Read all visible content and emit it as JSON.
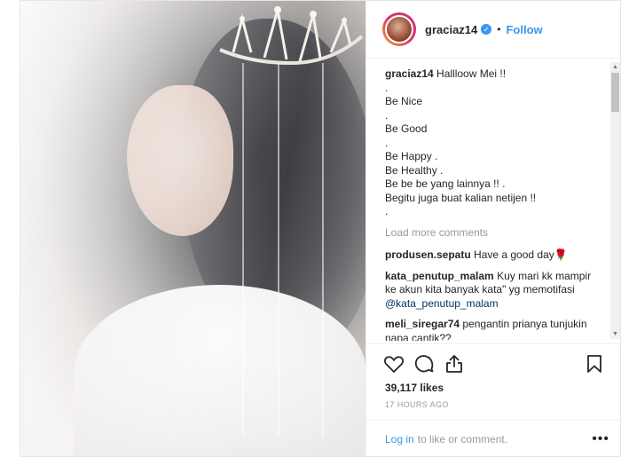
{
  "post": {
    "username": "graciaz14",
    "verified_mark": "✓",
    "separator": "•",
    "follow_label": "Follow",
    "caption": {
      "user": "graciaz14",
      "lines": [
        "Hallloow Mei !!",
        ".",
        "Be Nice",
        ".",
        "Be Good",
        ".",
        "Be Happy .",
        "Be Healthy .",
        "Be be be yang lainnya !! .",
        "Begitu juga buat kalian netijen !!",
        "."
      ]
    },
    "load_more": "Load more comments",
    "comments": [
      {
        "user": "produsen.sepatu",
        "text": "Have a good day",
        "emoji": "🌹"
      },
      {
        "user": "kata_penutup_malam",
        "text": "Kuy mari kk mampir",
        "text_line2": "ke akun kita banyak kata\" yg memotifasi",
        "mention": "@kata_penutup_malam"
      },
      {
        "user": "meli_siregar74",
        "text": "pengantin prianya tunjukin",
        "text_line2": "napa cantik??"
      }
    ],
    "likes": "39,117 likes",
    "time": "17 HOURS AGO",
    "login_link": "Log in",
    "login_rest": "to like or comment.",
    "more_icon": "•••"
  },
  "icons": [
    "heart-icon",
    "comment-icon",
    "share-icon",
    "bookmark-icon",
    "verified-badge-icon",
    "more-options-icon"
  ],
  "colors": {
    "link": "#3897f0",
    "muted": "#999999",
    "text": "#262626"
  }
}
